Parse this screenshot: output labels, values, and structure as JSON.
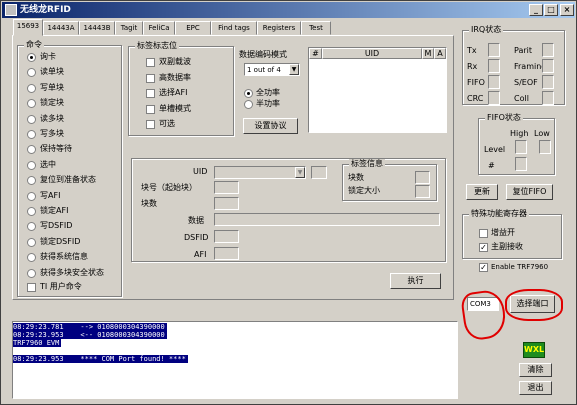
{
  "window": {
    "title": "无线龙RFID",
    "minimize": "_",
    "maximize": "□",
    "close": "×"
  },
  "tabs": [
    "15693",
    "14443A",
    "14443B",
    "Tagit",
    "FeliCa",
    "EPC",
    "Find tags",
    "Registers",
    "Test"
  ],
  "commands": {
    "legend": "命令",
    "items": [
      "询卡",
      "读单块",
      "写单块",
      "锁定块",
      "读多块",
      "写多块",
      "保持等待",
      "选中",
      "复位到准备状态",
      "写AFI",
      "锁定AFI",
      "写DSFID",
      "锁定DSFID",
      "获得系统信息",
      "获得多块安全状态"
    ],
    "selected_index": 0,
    "user_cmd": "TI 用户命令"
  },
  "tag_flags": {
    "legend": "标签标志位",
    "items": [
      "双副载波",
      "高数据率",
      "选择AFI",
      "单槽模式",
      "可选"
    ]
  },
  "data_mode": {
    "label": "数据编码模式",
    "value": "1 out of 4",
    "full_power": "全功率",
    "half_power": "半功率",
    "set_button": "设置协议"
  },
  "table": {
    "headers": [
      "#",
      "UID",
      "M",
      "A"
    ]
  },
  "uid_section": {
    "uid_label": "UID",
    "block_label": "块号（起始块）",
    "count_label": "块数",
    "data_label": "数据",
    "dsfid_label": "DSFID",
    "afi_label": "AFI",
    "execute": "执行"
  },
  "tag_info": {
    "legend": "标签信息",
    "block_count": "块数",
    "lock_size": "锁定大小"
  },
  "irq": {
    "legend": "IRQ状态",
    "tx": "Tx",
    "rx": "Rx",
    "fifo": "FIFO",
    "crc": "CRC",
    "parity": "Parit",
    "framing": "Framing",
    "sof_eof": "S/EOF",
    "coll": "Coll"
  },
  "fifo": {
    "legend": "FIFO状态",
    "high": "High",
    "low": "Low",
    "level": "Level",
    "count": "#"
  },
  "fifo_buttons": {
    "update": "更新",
    "reset": "复位FIFO"
  },
  "special": {
    "legend": "特殊功能寄存器",
    "items": [
      "增益开",
      "主副接收"
    ],
    "checked": [
      false,
      true
    ],
    "enable": "Enable TRF7960",
    "enable_checked": true
  },
  "port": {
    "value": "COM3",
    "select_button": "选择端口"
  },
  "log": [
    "08:29:23.781    --> 0108000304390000",
    "08:29:23.953    <-- 0108000304390000",
    "TRF7960 EVM",
    "",
    "08:29:23.953    **** COM Port found! ****"
  ],
  "side": {
    "logo": "WXL",
    "clear": "清除",
    "exit": "退出"
  },
  "colors": {
    "title_start": "#0a246a",
    "title_end": "#a6caf0",
    "log_highlight": "#000080",
    "annotation": "#e00000",
    "logo_bg": "#1e8c1e"
  }
}
